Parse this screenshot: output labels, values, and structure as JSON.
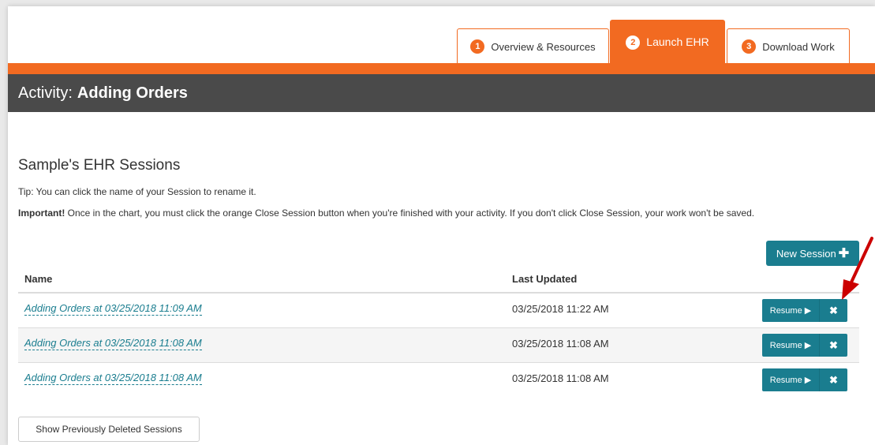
{
  "tabs": [
    {
      "num": "1",
      "label": "Overview & Resources"
    },
    {
      "num": "2",
      "label": "Launch EHR"
    },
    {
      "num": "3",
      "label": "Download Work"
    }
  ],
  "activity": {
    "prefix": "Activity:",
    "name": "Adding Orders"
  },
  "sessions_title": "Sample's EHR Sessions",
  "tip": "Tip: You can click the name of your Session to rename it.",
  "important": {
    "label": "Important!",
    "text": " Once in the chart, you must click the orange Close Session button when you're finished with your activity. If you don't click Close Session, your work won't be saved."
  },
  "new_session_label": "New Session",
  "table": {
    "headers": {
      "name": "Name",
      "last_updated": "Last Updated"
    },
    "rows": [
      {
        "name": "Adding Orders at 03/25/2018 11:09 AM",
        "updated": "03/25/2018 11:22 AM"
      },
      {
        "name": "Adding Orders at 03/25/2018 11:08 AM",
        "updated": "03/25/2018 11:08 AM"
      },
      {
        "name": "Adding Orders at 03/25/2018 11:08 AM",
        "updated": "03/25/2018 11:08 AM"
      }
    ]
  },
  "resume_label": "Resume ▶",
  "delete_glyph": "✖",
  "show_deleted_label": "Show Previously Deleted Sessions",
  "colors": {
    "accent": "#f26a21",
    "teal": "#1a7d8f",
    "title_bar": "#4a4a4a",
    "arrow": "#cc0000"
  }
}
